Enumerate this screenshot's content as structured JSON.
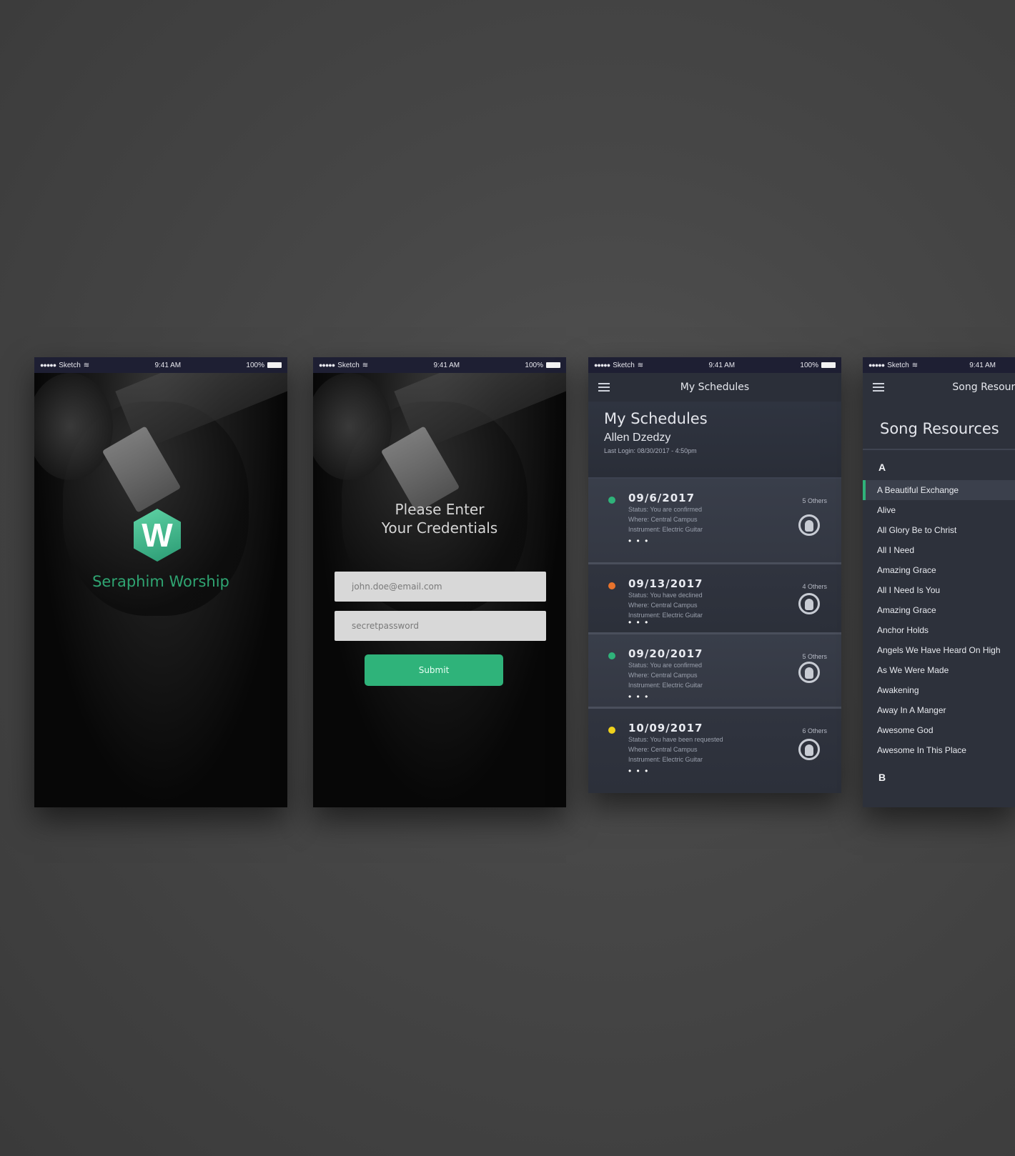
{
  "status_bar": {
    "carrier": "Sketch",
    "time": "9:41 AM",
    "battery": "100%"
  },
  "splash": {
    "logo_letter": "W",
    "brand": "Seraphim Worship"
  },
  "login": {
    "title_line1": "Please Enter",
    "title_line2": "Your Credentials",
    "email_placeholder": "john.doe@email.com",
    "password_placeholder": "secretpassword",
    "submit_label": "Submit"
  },
  "schedules": {
    "header_title": "My Schedules",
    "heading": "My Schedules",
    "user_name": "Allen Dzedzy",
    "last_login": "Last Login: 08/30/2017 - 4:50pm",
    "items": [
      {
        "date": "09/6/2017",
        "others": "5 Others",
        "dot_color": "#2fb37a",
        "line1": "Status: You are confirmed",
        "line2": "Where: Central Campus",
        "line3": "Instrument: Electric Guitar"
      },
      {
        "date": "09/13/2017",
        "others": "4 Others",
        "dot_color": "#e8732c",
        "line1": "Status: You have declined",
        "line2": "Where: Central Campus",
        "line3": "Instrument: Electric Guitar"
      },
      {
        "date": "09/20/2017",
        "others": "5 Others",
        "dot_color": "#2fb37a",
        "line1": "Status: You are confirmed",
        "line2": "Where: Central Campus",
        "line3": "Instrument: Electric Guitar"
      },
      {
        "date": "10/09/2017",
        "others": "6 Others",
        "dot_color": "#f0d21c",
        "line1": "Status: You have been requested",
        "line2": "Where: Central Campus",
        "line3": "Instrument: Electric Guitar"
      }
    ],
    "more_glyph": "• • •"
  },
  "songs": {
    "header_title": "Song Resources",
    "heading": "Song Resources",
    "letter_a": "A",
    "letter_b": "B",
    "items": [
      "A Beautiful Exchange",
      "Alive",
      "All Glory Be to Christ",
      "All I Need",
      "Amazing Grace",
      "All I Need Is You",
      "Amazing Grace",
      "Anchor Holds",
      "Angels We Have Heard On High",
      "As We Were Made",
      "Awakening",
      "Away In A Manger",
      "Awesome God",
      "Awesome In This Place"
    ]
  },
  "colors": {
    "accent": "#2fb37a",
    "status_bar": "#1e1f33"
  }
}
